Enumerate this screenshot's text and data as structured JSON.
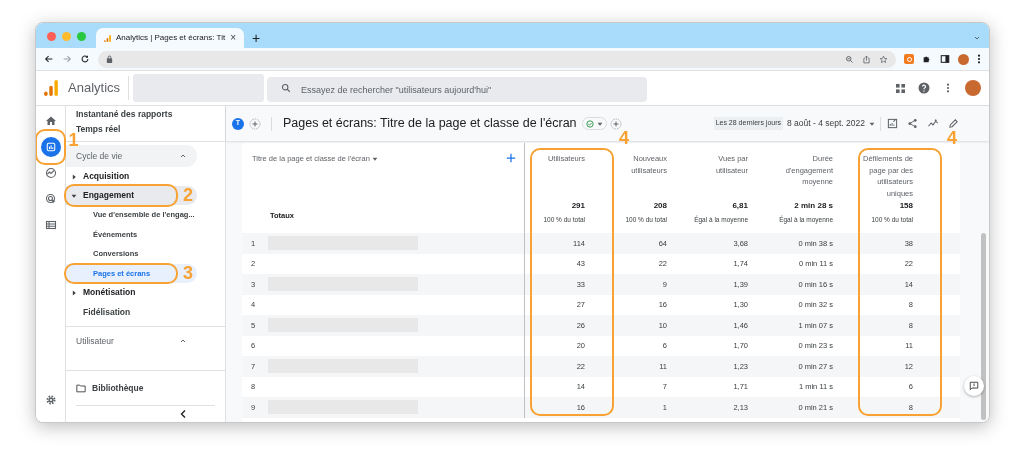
{
  "browser": {
    "tab_title": "Analytics | Pages et écrans: Tit",
    "tab_close": "×",
    "new_tab": "+"
  },
  "app_header": {
    "product": "Analytics",
    "search_placeholder": "Essayez de rechercher \"utilisateurs aujourd'hui\""
  },
  "rail": {
    "items": [
      {
        "kind": "home",
        "selected": false
      },
      {
        "kind": "reports",
        "selected": true,
        "callout": "1"
      },
      {
        "kind": "explore",
        "selected": false
      },
      {
        "kind": "advertising",
        "selected": false
      },
      {
        "kind": "configure",
        "selected": false
      }
    ]
  },
  "sidebar": {
    "items": [
      {
        "kind": "link",
        "label": "Instantané des rapports"
      },
      {
        "kind": "link",
        "label": "Temps réel"
      },
      {
        "kind": "section",
        "label": "Cycle de vie",
        "expanded": true,
        "children": [
          {
            "kind": "group",
            "label": "Acquisition",
            "expanded": false
          },
          {
            "kind": "group",
            "label": "Engagement",
            "expanded": true,
            "callout": "2",
            "children": [
              {
                "label": "Vue d'ensemble de l'engag...",
                "selected": false
              },
              {
                "label": "Événements",
                "selected": false
              },
              {
                "label": "Conversions",
                "selected": false
              },
              {
                "label": "Pages et écrans",
                "selected": true,
                "callout": "3"
              }
            ]
          },
          {
            "kind": "group",
            "label": "Monétisation",
            "expanded": false
          },
          {
            "kind": "leaf",
            "label": "Fidélisation"
          }
        ]
      },
      {
        "kind": "section",
        "label": "Utilisateur",
        "expanded": true
      },
      {
        "kind": "library",
        "label": "Bibliothèque"
      }
    ]
  },
  "report": {
    "avatar": "T",
    "title": "Pages et écrans: Titre de la page et classe de l'écran",
    "date_label": "Les 28 derniers jours",
    "date_range": "8 août - 4 sept. 2022"
  },
  "table": {
    "dimension_header": "Titre de la page et classe de l'écran",
    "totals_label": "Totaux",
    "columns": [
      {
        "label": "Utilisateurs",
        "total": "291",
        "note": "100 % du total",
        "callout": "4"
      },
      {
        "label": "Nouveaux utilisateurs",
        "total": "208",
        "note": "100 % du total"
      },
      {
        "label": "Vues par utilisateur",
        "total": "6,81",
        "note": "Égal à la moyenne"
      },
      {
        "label": "Durée d'engagement moyenne",
        "total": "2 min 28 s",
        "note": "Égal à la moyenne"
      },
      {
        "label": "Défilements de page par des utilisateurs uniques",
        "total": "158",
        "note": "100 % du total",
        "callout": "4"
      }
    ],
    "rows": [
      {
        "index": "1",
        "redacted": true,
        "values": [
          "114",
          "64",
          "3,68",
          "0 min 38 s",
          "38"
        ]
      },
      {
        "index": "2",
        "redacted": false,
        "values": [
          "43",
          "22",
          "1,74",
          "0 min 11 s",
          "22"
        ]
      },
      {
        "index": "3",
        "redacted": true,
        "values": [
          "33",
          "9",
          "1,39",
          "0 min 16 s",
          "14"
        ]
      },
      {
        "index": "4",
        "redacted": false,
        "values": [
          "27",
          "16",
          "1,30",
          "0 min 32 s",
          "8"
        ]
      },
      {
        "index": "5",
        "redacted": true,
        "values": [
          "26",
          "10",
          "1,46",
          "1 min 07 s",
          "8"
        ]
      },
      {
        "index": "6",
        "redacted": false,
        "values": [
          "20",
          "6",
          "1,70",
          "0 min 23 s",
          "11"
        ]
      },
      {
        "index": "7",
        "redacted": true,
        "values": [
          "22",
          "11",
          "1,23",
          "0 min 27 s",
          "12"
        ]
      },
      {
        "index": "8",
        "redacted": false,
        "values": [
          "14",
          "7",
          "1,71",
          "1 min 11 s",
          "6"
        ]
      },
      {
        "index": "9",
        "redacted": true,
        "values": [
          "16",
          "1",
          "2,13",
          "0 min 21 s",
          "8"
        ]
      }
    ]
  }
}
